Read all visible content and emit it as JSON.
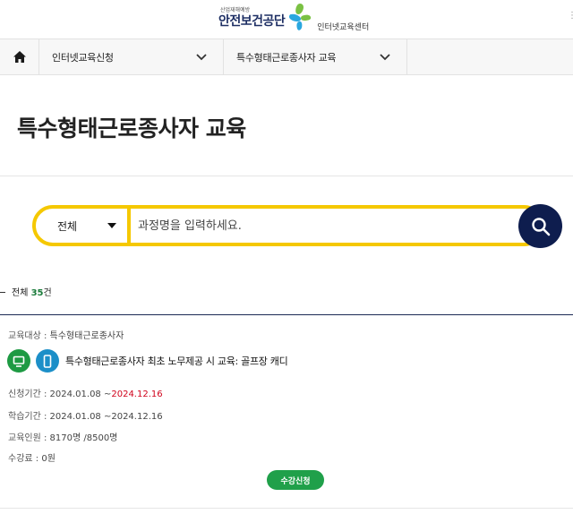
{
  "header": {
    "logo_small": "산업재해예방",
    "logo_main": "안전보건공단",
    "logo_sub": "인터넷교육센터",
    "colors": {
      "navy": "#1d2e63",
      "green": "#7ac143",
      "blue": "#2aa7df"
    }
  },
  "nav": {
    "home_icon": "home-icon",
    "dropdown1": "인터넷교육신청",
    "dropdown2": "특수형태근로종사자 교육"
  },
  "page": {
    "title": "특수형태근로종사자 교육"
  },
  "search": {
    "category": "전체",
    "placeholder": "과정명을 입력하세요.",
    "accent_color": "#f5c800",
    "button_icon": "search-icon"
  },
  "results": {
    "prefix": "전체",
    "count": "35",
    "suffix": "건"
  },
  "course": {
    "target_label": "교육대상 : ",
    "target_value": "특수형태근로종사자",
    "device_icons": [
      "pc-icon",
      "mobile-icon"
    ],
    "title": "특수형태근로종사자 최초 노무제공 시 교육: 골프장 캐디",
    "apply_label": "신청기간 : ",
    "apply_start": "2024.01.08 ~",
    "apply_end": "2024.12.16",
    "study_label": "학습기간 : ",
    "study_value": "2024.01.08 ~2024.12.16",
    "capacity_label": "교육인원 : ",
    "capacity_value": "8170명 /8500명",
    "fee_label": "수강료 : ",
    "fee_value": "0원",
    "button": "수강신청"
  }
}
